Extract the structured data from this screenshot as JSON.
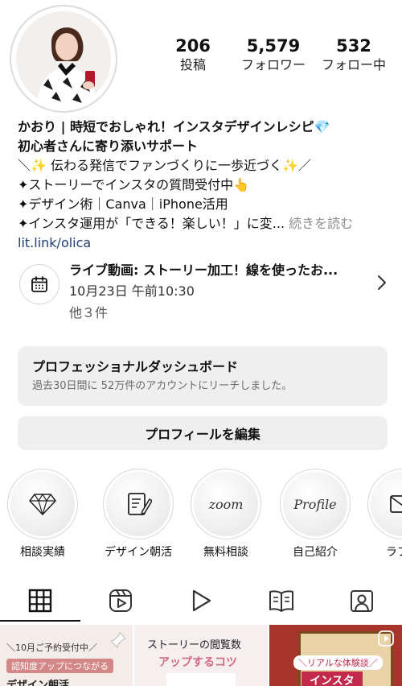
{
  "profile": {
    "stats": [
      {
        "value": "206",
        "label": "投稿"
      },
      {
        "value": "5,579",
        "label": "フォロワー"
      },
      {
        "value": "532",
        "label": "フォロー中"
      }
    ],
    "bio": {
      "name_line": "かおり | 時短でおしゃれ！インスタデザインレシピ💎",
      "line2": "初心者さんに寄り添いサポート",
      "line3": "＼✨ 伝わる発信でファンづくりに一歩近づく✨／",
      "line4": "✦ストーリーでインスタの質問受付中👆",
      "line5": "✦デザイン術｜Canva｜iPhone活用",
      "line6": "✦インスタ運用が「できる！楽しい！」に変...",
      "more": "続きを読む",
      "link": "lit.link/olica"
    }
  },
  "event": {
    "title": "ライブ動画: ストーリー加工！線を使ったお...",
    "date": "10月23日 午前10:30",
    "more": "他３件",
    "icon": "calendar-icon"
  },
  "dashboard": {
    "title": "プロフェッショナルダッシュボード",
    "subtitle": "過去30日間に 52万件のアカウントにリーチしました。"
  },
  "edit_profile_label": "プロフィールを編集",
  "highlights": [
    {
      "label": "相談実績",
      "icon": "diamond-icon",
      "text": ""
    },
    {
      "label": "デザイン朝活",
      "icon": "notepad-pen-icon",
      "text": ""
    },
    {
      "label": "無料相談",
      "icon": "",
      "text": "zoom"
    },
    {
      "label": "自己紹介",
      "icon": "",
      "text": "Profile"
    },
    {
      "label": "ラブレ",
      "icon": "envelope-icon",
      "text": ""
    }
  ],
  "tabs": [
    {
      "name": "posts",
      "icon": "grid-icon",
      "active": true
    },
    {
      "name": "reels",
      "icon": "reels-icon",
      "active": false
    },
    {
      "name": "videos",
      "icon": "play-icon",
      "active": false
    },
    {
      "name": "guides",
      "icon": "book-icon",
      "active": false
    },
    {
      "name": "tagged",
      "icon": "tagged-person-icon",
      "active": false
    }
  ],
  "grid_posts": [
    {
      "line1": "＼10月ご予約受付中／",
      "line2": "認知度アップにつながる",
      "line3": "デザイン朝活"
    },
    {
      "line1": "ストーリーの閲覧数",
      "line2": "アップするコツ"
    },
    {
      "line1": "＼リアルな体験談／",
      "line2": "インスタ"
    }
  ],
  "colors": {
    "link": "#1f3d73",
    "muted": "#8e8e8e",
    "card_bg": "#efefef",
    "grid_tile_1": "#f4ece8",
    "grid_tile_2": "#f7eef0",
    "grid_tile_3": "#a8352c"
  }
}
